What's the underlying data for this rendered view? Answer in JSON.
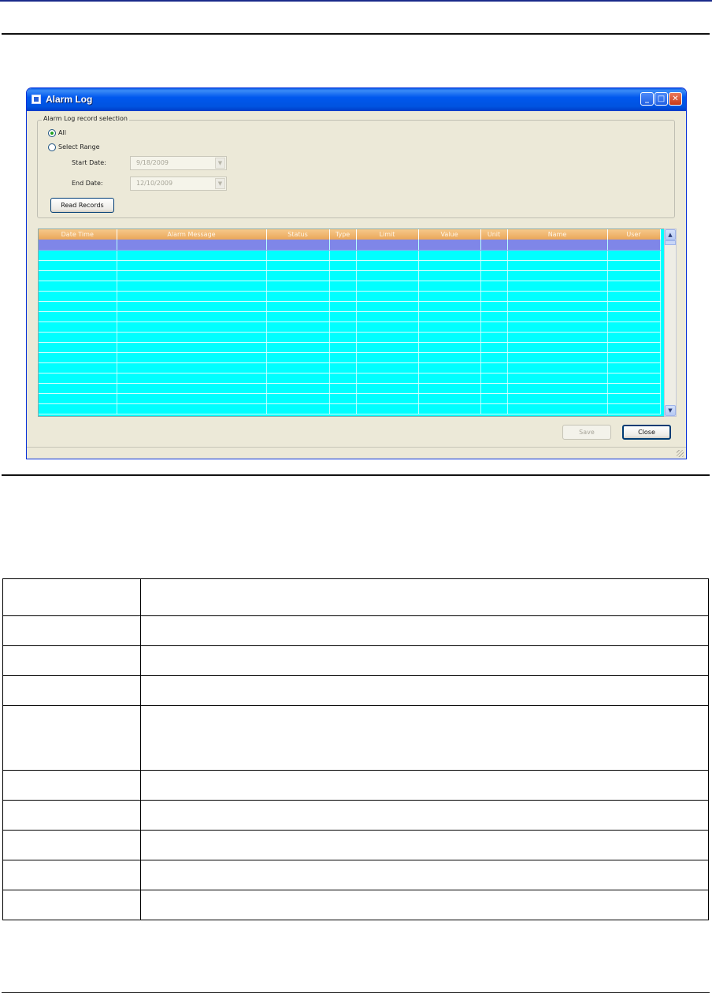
{
  "window": {
    "title": "Alarm Log"
  },
  "selection_group": {
    "legend": "Alarm Log record selection",
    "option_all": "All",
    "option_range": "Select Range",
    "selected": "All",
    "start_date_label": "Start Date:",
    "start_date_value": "9/18/2009",
    "end_date_label": "End Date:",
    "end_date_value": "12/10/2009",
    "read_button": "Read Records"
  },
  "grid": {
    "columns": [
      "Date Time",
      "Alarm Message",
      "Status",
      "Type",
      "Limit",
      "Value",
      "Unit",
      "Name",
      "User"
    ],
    "row_count": 17,
    "selected_row": 0,
    "colors": {
      "row_background": "#00ffff",
      "selected_row": "#7f86e8",
      "header": "#eaa65a"
    }
  },
  "buttons": {
    "save": "Save",
    "close": "Close"
  },
  "doc_table": {
    "row_count": 10
  }
}
